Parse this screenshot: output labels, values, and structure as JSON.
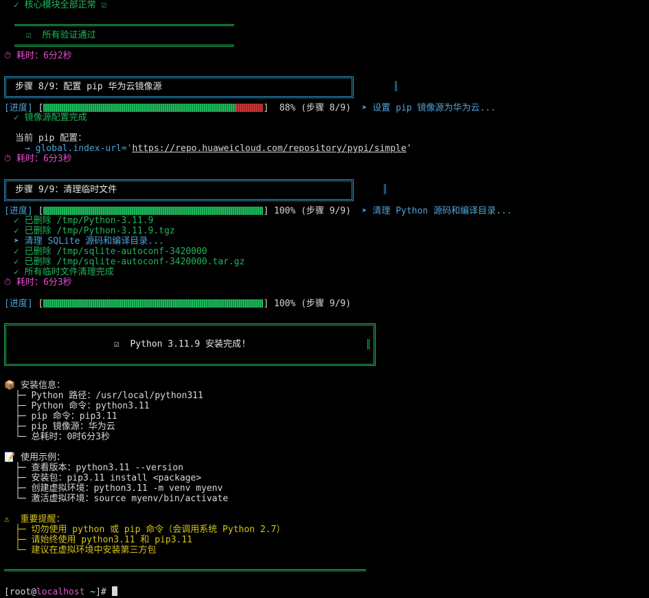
{
  "top": {
    "core_ok": "✓ 核心模块全部正常 ☑",
    "all_pass": "☑  所有验证通过",
    "elapsed1": "⏱ 耗时：6分2秒"
  },
  "step8": {
    "title": "步骤 8/9：配置 pip 华为云镜像源",
    "progress_label": "[进度]",
    "progress_pct_text": "88% (步骤 8/9)",
    "progress_value": 0.88,
    "action": "➤ 设置 pip 镜像源为华为云...",
    "done": "✓ 镜像源配置完成",
    "config_head": "当前 pip 配置：",
    "config_prefix": "→ global.index-url='",
    "config_url": "https://repo.huaweicloud.com/repository/pypi/simple",
    "config_suffix": "'",
    "elapsed": "⏱ 耗时：6分3秒"
  },
  "step9": {
    "title": "步骤 9/9：清理临时文件",
    "progress_label": "[进度]",
    "progress_pct_text": "100% (步骤 9/9)",
    "progress_value": 1.0,
    "action": "➤ 清理 Python 源码和编译目录...",
    "lines": [
      "✓ 已删除 /tmp/Python-3.11.9",
      "✓ 已删除 /tmp/Python-3.11.9.tgz",
      "➤ 清理 SQLite 源码和编译目录...",
      "✓ 已删除 /tmp/sqlite-autoconf-3420000",
      "✓ 已删除 /tmp/sqlite-autoconf-3420000.tar.gz",
      "✓ 所有临时文件清理完成"
    ],
    "elapsed": "⏱ 耗时：6分3秒"
  },
  "final_progress": {
    "label": "[进度]",
    "pct_text": "100% (步骤 9/9)",
    "value": 1.0
  },
  "banner": "☑  Python 3.11.9 安装完成!",
  "info": {
    "head": "📦 安装信息：",
    "items": [
      "├─ Python 路径：/usr/local/python311",
      "├─ Python 命令：python3.11",
      "├─ pip 命令：pip3.11",
      "├─ pip 镜像源：华为云",
      "└─ 总耗时：0时6分3秒"
    ]
  },
  "usage": {
    "head": "📝 使用示例：",
    "items": [
      "├─ 查看版本：python3.11 --version",
      "├─ 安装包：pip3.11 install <package>",
      "├─ 创建虚拟环境：python3.11 -m venv myenv",
      "└─ 激活虚拟环境：source myenv/bin/activate"
    ]
  },
  "warn": {
    "head": "⚠  重要提醒：",
    "items": [
      "├─ 切勿使用 python 或 pip 命令（会调用系统 Python 2.7）",
      "├─ 请始终使用 python3.11 和 pip3.11",
      "└─ 建议在虚拟环境中安装第三方包"
    ]
  },
  "prompt": {
    "open": "[root",
    "at": "@",
    "host": "localhost",
    "rest": " ~]# "
  },
  "colors": {
    "green": "#1fb75a",
    "cyan": "#4fa3d8",
    "magenta": "#e64fd0",
    "yellow": "#d8c418",
    "red": "#c43838"
  }
}
